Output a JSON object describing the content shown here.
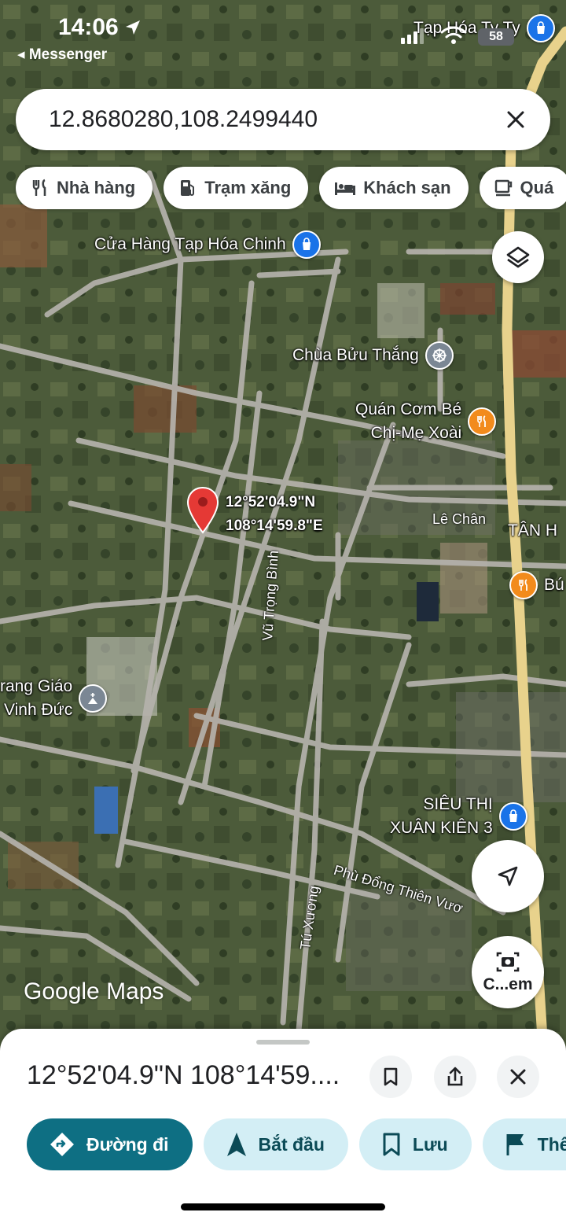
{
  "status_bar": {
    "time": "14:06",
    "back_app": "◂ Messenger",
    "battery": "58"
  },
  "search": {
    "value": "12.8680280,108.2499440"
  },
  "chips": [
    {
      "icon": "restaurant-icon",
      "label": "Nhà hàng"
    },
    {
      "icon": "gas-station-icon",
      "label": "Trạm xăng"
    },
    {
      "icon": "hotel-icon",
      "label": "Khách sạn"
    },
    {
      "icon": "cafe-icon",
      "label": "Quá"
    }
  ],
  "map": {
    "pois": {
      "tap_hoa_ty_ty": "Tạp Hóa Ty Ty",
      "cua_hang_chinh": "Cửa Hàng Tạp Hóa Chinh",
      "chua_buu_thang": "Chùa Bửu Thắng",
      "quan_com_line1": "Quán Cơm Bé",
      "quan_com_line2": "Chị-Mẹ Xoài",
      "nghia_trang_line1": "rang Giáo",
      "nghia_trang_line2": "Vinh Đức",
      "sieu_thi_line1": "SIÊU THỊ",
      "sieu_thi_line2": "XUÂN KIÊN 3",
      "bu": "Bú",
      "tan_h": "TÂN H"
    },
    "pin_coords_line1": "12°52'04.9\"N",
    "pin_coords_line2": "108°14'59.8\"E",
    "streets": {
      "le_chan": "Lê Chân",
      "vu_trong_binh": "Vũ Trọng Bình",
      "phu_dong": "Phù Đổng Thiên Vươ",
      "tu_xuong": "Tú Xương"
    },
    "logo": "Google Maps",
    "lens_label": "C...em"
  },
  "sheet": {
    "title": "12°52'04.9\"N 108°14'59....",
    "actions": [
      {
        "icon": "directions-icon",
        "label": "Đường đi"
      },
      {
        "icon": "navigation-icon",
        "label": "Bắt đầu"
      },
      {
        "icon": "bookmark-icon",
        "label": "Lưu"
      },
      {
        "icon": "flag-icon",
        "label": "Thê"
      }
    ]
  },
  "colors": {
    "primary_action": "#0e6f83",
    "secondary_action": "#d3eef5",
    "pin": "#e53935",
    "poi_blue": "#1a73e8",
    "poi_orange": "#f28b1c",
    "highway": "#e8d28c"
  }
}
